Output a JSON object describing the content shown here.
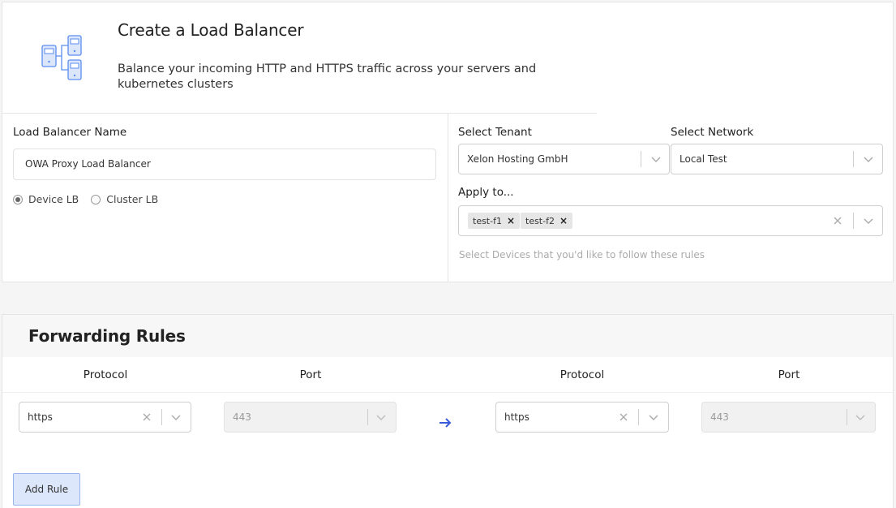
{
  "header": {
    "title": "Create a Load Balancer",
    "description": "Balance your incoming HTTP and HTTPS traffic across your servers and kubernetes clusters",
    "icon": "server-tree-icon"
  },
  "form": {
    "name_label": "Load Balancer Name",
    "name_value": "OWA Proxy Load Balancer",
    "lb_type": {
      "options": [
        "Device LB",
        "Cluster LB"
      ],
      "selected": "Device LB"
    },
    "tenant_label": "Select Tenant",
    "tenant_value": "Xelon Hosting GmbH",
    "network_label": "Select Network",
    "network_value": "Local Test",
    "apply_label": "Apply to...",
    "apply_tags": [
      "test-f1",
      "test-f2"
    ],
    "apply_hint": "Select Devices that you'd like to follow these rules"
  },
  "rules": {
    "title": "Forwarding Rules",
    "headers": [
      "Protocol",
      "Port",
      "Protocol",
      "Port"
    ],
    "rows": [
      {
        "src_protocol": "https",
        "src_port": "443",
        "dst_protocol": "https",
        "dst_port": "443"
      }
    ],
    "add_label": "Add Rule"
  },
  "colors": {
    "accent": "#3b5bdb",
    "icon": "#5b8def",
    "button_bg": "#dce7fb"
  }
}
